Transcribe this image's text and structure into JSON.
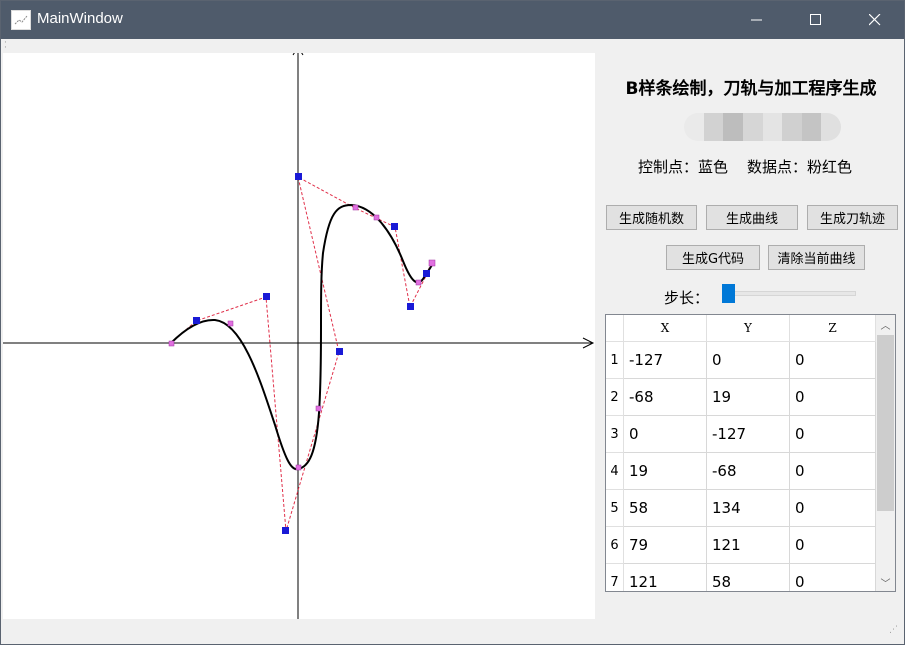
{
  "window": {
    "title": "MainWindow",
    "minimize_glyph": "—",
    "maximize_glyph": "☐",
    "close_glyph": "✕"
  },
  "panel": {
    "title": "B样条绘制，刀轨与加工程序生成",
    "legend": "控制点：蓝色    数据点：粉红色",
    "blurred_colors": [
      "#eaeaea",
      "#d2d2d2",
      "#bdbdbd",
      "#d6d6d6",
      "#e4e4e4",
      "#d0d0d0",
      "#c4c4c4",
      "#e0e0e0"
    ]
  },
  "buttons": {
    "random": "生成随机数",
    "curve": "生成曲线",
    "toolpath": "生成刀轨迹",
    "gcode": "生成G代码",
    "clear": "清除当前曲线"
  },
  "step": {
    "label": "步长：",
    "value_fraction": 0.0
  },
  "table": {
    "columns": [
      "X",
      "Y",
      "Z"
    ],
    "rows": [
      {
        "num": "1",
        "x": "-127",
        "y": "0",
        "z": "0"
      },
      {
        "num": "2",
        "x": "-68",
        "y": "19",
        "z": "0"
      },
      {
        "num": "3",
        "x": "0",
        "y": "-127",
        "z": "0"
      },
      {
        "num": "4",
        "x": "19",
        "y": "-68",
        "z": "0"
      },
      {
        "num": "5",
        "x": "58",
        "y": "134",
        "z": "0"
      },
      {
        "num": "6",
        "x": "79",
        "y": "121",
        "z": "0"
      },
      {
        "num": "7",
        "x": "121",
        "y": "58",
        "z": "0"
      }
    ],
    "scroll_up_glyph": "︿",
    "scroll_down_glyph": "﹀"
  },
  "colors": {
    "titlebar": "#4f5b6b",
    "control_point": "#1a1ad6",
    "data_point": "#e070e0",
    "control_polygon": "#e0304a",
    "curve": "#000000",
    "accent": "#0078d7"
  }
}
